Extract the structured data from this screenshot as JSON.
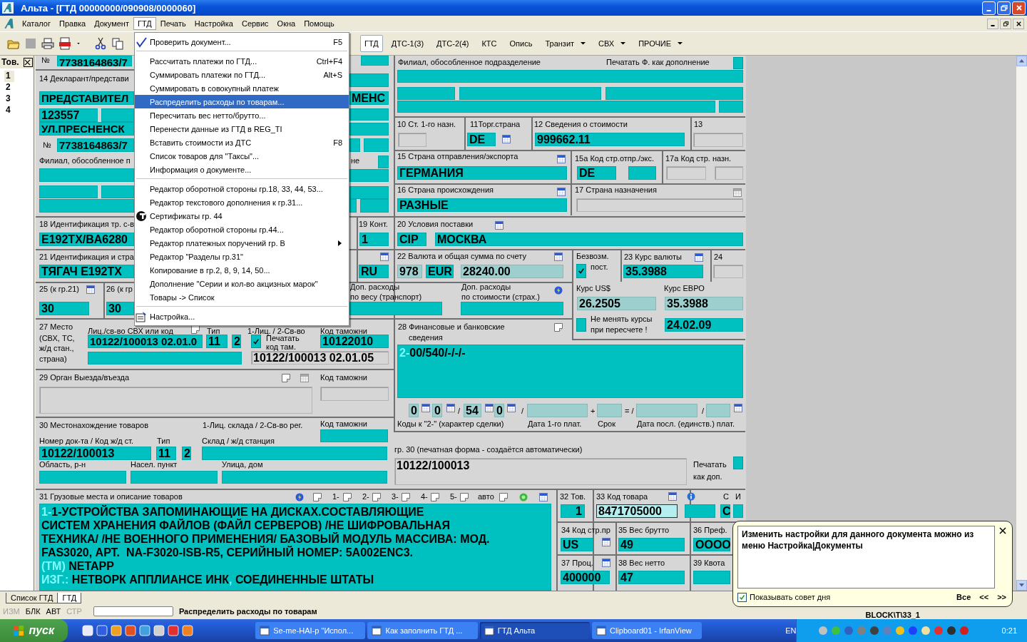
{
  "window": {
    "title": "Альта - [ГТД 00000000/090908/0000060]"
  },
  "menu_bar": [
    {
      "label": "Каталог",
      "open": false
    },
    {
      "label": "Правка",
      "open": false
    },
    {
      "label": "Документ",
      "open": false
    },
    {
      "label": "ГТД",
      "open": true
    },
    {
      "label": "Печать",
      "open": false
    },
    {
      "label": "Настройка",
      "open": false
    },
    {
      "label": "Сервис",
      "open": false
    },
    {
      "label": "Окна",
      "open": false
    },
    {
      "label": "Помощь",
      "open": false
    }
  ],
  "toolbar_tabs": [
    {
      "label": "ГТД",
      "selected": true,
      "dropdown": false
    },
    {
      "label": "ДТС-1(3)",
      "selected": false,
      "dropdown": false
    },
    {
      "label": "ДТС-2(4)",
      "selected": false,
      "dropdown": false
    },
    {
      "label": "КТС",
      "selected": false,
      "dropdown": false
    },
    {
      "label": "Опись",
      "selected": false,
      "dropdown": false
    },
    {
      "label": "Транзит",
      "selected": false,
      "dropdown": true
    },
    {
      "label": "СВХ",
      "selected": false,
      "dropdown": true
    },
    {
      "label": "ПРОЧИЕ",
      "selected": false,
      "dropdown": true
    }
  ],
  "gtd_menu": [
    {
      "kind": "item",
      "label": "Проверить документ...",
      "shortcut": "F5",
      "selected": false,
      "submenu": false
    },
    {
      "kind": "separator"
    },
    {
      "kind": "item",
      "label": "Рассчитать платежи по ГТД...",
      "shortcut": "Ctrl+F4",
      "selected": false,
      "submenu": false
    },
    {
      "kind": "item",
      "label": "Суммировать платежи по ГТД...",
      "shortcut": "Alt+S",
      "selected": false,
      "submenu": false
    },
    {
      "kind": "item",
      "label": "Суммировать в совокупный платеж",
      "selected": false,
      "submenu": false
    },
    {
      "kind": "item",
      "label": "Распределить расходы по товарам...",
      "selected": true,
      "submenu": false
    },
    {
      "kind": "item",
      "label": "Пересчитать вес нетто/брутто...",
      "selected": false,
      "submenu": false
    },
    {
      "kind": "item",
      "label": "Перенести данные из ГТД в REG_TI",
      "selected": false,
      "submenu": false
    },
    {
      "kind": "item",
      "label": "Вставить стоимости из ДТС",
      "shortcut": "F8",
      "selected": false,
      "submenu": false
    },
    {
      "kind": "item",
      "label": "Список товаров для \"Таксы\"...",
      "selected": false,
      "submenu": false
    },
    {
      "kind": "item",
      "label": "Информация о документе...",
      "selected": false,
      "submenu": false
    },
    {
      "kind": "separator"
    },
    {
      "kind": "item",
      "label": "Редактор оборотной стороны гр.18, 33, 44, 53...",
      "selected": false,
      "submenu": false
    },
    {
      "kind": "item",
      "label": "Редактор текстового дополнения к гр.31...",
      "selected": false,
      "submenu": false
    },
    {
      "kind": "item",
      "label": "Сертификаты гр. 44",
      "selected": false,
      "submenu": false
    },
    {
      "kind": "item",
      "label": "Редактор оборотной стороны гр.44...",
      "selected": false,
      "submenu": false
    },
    {
      "kind": "item",
      "label": "Редактор платежных поручений гр. B",
      "selected": false,
      "submenu": true
    },
    {
      "kind": "item",
      "label": "Редактор \"Разделы гр.31\"",
      "selected": false,
      "submenu": false
    },
    {
      "kind": "item",
      "label": "Копирование в гр.2, 8, 9, 14, 50...",
      "selected": false,
      "submenu": false
    },
    {
      "kind": "item",
      "label": "Дополнение \"Серии и кол-во акцизных марок\"",
      "selected": false,
      "submenu": false
    },
    {
      "kind": "item",
      "label": "Товары -> Список",
      "selected": false,
      "submenu": false
    },
    {
      "kind": "separator"
    },
    {
      "kind": "item",
      "label": "Настройка...",
      "selected": false,
      "submenu": false
    }
  ],
  "goods_list": {
    "header": "Тов.",
    "items": [
      {
        "label": "1",
        "selected": true
      },
      {
        "label": "2",
        "selected": false
      },
      {
        "label": "3",
        "selected": false
      },
      {
        "label": "4",
        "selected": false
      }
    ]
  },
  "form": {
    "sections": [
      {
        "labels": [
          "№",
          "14 Декларант/представи",
          "№",
          "Филиал, обособленное п",
          "не"
        ],
        "fields": [
          {
            "value": "7738164863/7"
          },
          {
            "value": "ПРЕДСТАВИТЕЛ"
          },
          {
            "value": "МЕНС"
          },
          {
            "value": "123557"
          },
          {
            "value": "УЛ.ПРЕСНЕНСК"
          },
          {
            "value": "7738164863/7"
          }
        ]
      },
      {
        "labels": [
          "Филиал, обособленное подразделение",
          "Печатать Ф. как дополнение"
        ],
        "checkboxes": [
          {
            "checked": false
          }
        ]
      },
      {
        "labels": [
          "10 Ст. 1-го назн.",
          "11Торг.страна",
          "12 Сведения о стоимости",
          "13"
        ],
        "fields": [
          {
            "value": "DE"
          },
          {
            "value": "999662.11"
          }
        ]
      },
      {
        "labels": [
          "15 Страна отправления/экспорта",
          "15а Код стр.отпр./экс.",
          "17а Код стр. назн."
        ],
        "fields": [
          {
            "value": "ГЕРМАНИЯ"
          },
          {
            "value": "DE"
          }
        ]
      },
      {
        "labels": [
          "16 Страна происхождения",
          "17 Страна назначения"
        ],
        "fields": [
          {
            "value": "РАЗНЫЕ"
          }
        ]
      },
      {
        "labels": [
          "18 Идентификация тр. с-в",
          "19 Конт.",
          "20 Условия поставки"
        ],
        "fields": [
          {
            "value": "E192TX/BA6280"
          },
          {
            "value": "1"
          },
          {
            "value": "CIP"
          },
          {
            "value": "МОСКВА"
          }
        ]
      },
      {
        "labels": [
          "21 Идентификация и стра",
          "22 Валюта и общая сумма по счету",
          "Безвозм.",
          "пост.",
          "23 Курс валюты",
          "24"
        ],
        "fields": [
          {
            "value": "ТЯГАЧ E192TX"
          },
          {
            "value": "RU"
          },
          {
            "value": "978"
          },
          {
            "value": "EUR"
          },
          {
            "value": "28240.00"
          },
          {
            "value": "35.3988"
          }
        ],
        "checkboxes": [
          {
            "checked": true
          }
        ]
      },
      {
        "labels": [
          "25 (к гр.21)",
          "26 (к гр",
          "Доп. расходы",
          "по весу (транспорт)",
          "Доп. расходы",
          "по стоимости (страх.)"
        ],
        "fields": [
          {
            "value": "30"
          },
          {
            "value": "30"
          }
        ]
      },
      {
        "labels": [
          "Курс US$",
          "Курс ЕВРО",
          "Не менять курсы",
          "при пересчете !"
        ],
        "fields": [
          {
            "value": "26.2505"
          },
          {
            "value": "35.3988"
          },
          {
            "value": "24.02.09"
          }
        ],
        "checkboxes": [
          {
            "checked": false
          }
        ]
      },
      {
        "labels": [
          "27  Место",
          "(СВХ, ТС,",
          "ж/д стан.,",
          "страна)",
          "Лиц./св-во СВХ или код",
          "Тип",
          "1-Лиц. / 2-Св-во",
          "Код таможни",
          "Печатать",
          "код там.",
          "28 Финансовые и банковские",
          "сведения",
          "/",
          "/",
          "+",
          "= /",
          "/",
          "Коды к \"2-\" (характер сделки)",
          "Дата 1-го плат.",
          "Срок",
          "Дата посл. (единств.) плат."
        ],
        "fields": [
          {
            "value": "10122/100013 02.01.0"
          },
          {
            "value": "11"
          },
          {
            "value": "2"
          },
          {
            "value": "10122010"
          },
          {
            "value": "10122/100013 02.01.05"
          },
          {
            "value": "0"
          },
          {
            "value": "0"
          },
          {
            "value": "54"
          },
          {
            "value": "0"
          }
        ],
        "checkboxes": [
          {
            "checked": true
          }
        ]
      },
      {
        "labels": [
          "29 Орган Выезда/въезда",
          "Код таможни"
        ]
      },
      {
        "labels": [
          "30 Местонахождение товаров",
          "1-Лиц. склада / 2-Св-во рег.",
          "Код таможни",
          "Номер док-та / Код ж/д ст.",
          "Тип",
          "Склад / ж/д станция",
          "Область, р-н",
          "Насел. пункт",
          "Улица, дом"
        ],
        "fields": [
          {
            "value": "10122/100013"
          },
          {
            "value": "11"
          },
          {
            "value": "2"
          }
        ]
      },
      {
        "labels": [
          "гр. 30 (печатная форма - создаётся автоматически)",
          "Печатать",
          "как доп."
        ],
        "fields": [
          {
            "value": "10122/100013"
          }
        ],
        "checkboxes": [
          {
            "checked": false
          }
        ]
      },
      {
        "labels": [
          "31 Грузовые места и описание товаров",
          "1-",
          "2-",
          "3-",
          "4-",
          "5-",
          "авто"
        ]
      },
      {
        "labels": [
          "32 Тов.",
          "33 Код товара",
          "С",
          "И",
          "34 Код стр.пр",
          "35 Вес брутто",
          "36 Преф.",
          "37 Проц.",
          "38 Вес нетто",
          "39 Квота"
        ],
        "fields": [
          {
            "value": "1"
          },
          {
            "value": "8471705000"
          },
          {
            "value": "С"
          },
          {
            "value": "US"
          },
          {
            "value": "49"
          },
          {
            "value": "ОООО"
          },
          {
            "value": "400000"
          },
          {
            "value": "47"
          }
        ]
      }
    ],
    "financial_details": [
      {
        "text": "2-",
        "kind": "prefix"
      },
      {
        "text": "00/540/-/-/-",
        "kind": "body"
      }
    ],
    "goods_description": [
      [
        {
          "text": "1-",
          "kind": "prefix"
        },
        {
          "text": "1-УСТРОЙСТВА ЗАПОМИНАЮЩИЕ НА ДИСКАХ.СОСТАВЛЯЮЩИЕ",
          "kind": "body"
        }
      ],
      [
        {
          "text": "СИСТЕМ ХРАНЕНИЯ ФАЙЛОВ (ФАЙЛ СЕРВЕРОВ) /НЕ ШИФРОВАЛЬНАЯ",
          "kind": "body"
        }
      ],
      [
        {
          "text": "ТЕХНИКА/ /НЕ ВОЕННОГО ПРИМЕНЕНИЯ/ БАЗОВЫЙ МОДУЛЬ МАССИВА: МОД.",
          "kind": "body"
        }
      ],
      [
        {
          "text": "FAS3020, АРТ.  NA-F3020-ISB-R5, СЕРИЙНЫЙ НОМЕР: 5A002ENC3.",
          "kind": "body"
        }
      ],
      [
        {
          "text": "(ТМ)",
          "kind": "prefix"
        },
        {
          "text": " NETAPP",
          "kind": "body"
        }
      ],
      [
        {
          "text": "ИЗГ.:",
          "kind": "prefix"
        },
        {
          "text": " НЕТВОРК АППЛИАНСЕ ИНК",
          "kind": "body"
        },
        {
          "text": ",",
          "kind": "prefix"
        },
        {
          "text": " СОЕДИНЕННЫЕ ШТАТЫ",
          "kind": "body"
        }
      ]
    ]
  },
  "document_tabs": [
    {
      "label": "Список ГТД",
      "selected": false
    },
    {
      "label": "ГТД",
      "selected": true
    }
  ],
  "status_bar": {
    "indicators": [
      {
        "label": "ИЗМ",
        "on": false
      },
      {
        "label": "БЛК",
        "on": true
      },
      {
        "label": "АВТ",
        "on": true
      },
      {
        "label": "СТР",
        "on": false
      }
    ],
    "message": "Распределить расходы по товарам",
    "block": "BLOCK\\T\\33_1"
  },
  "tip": {
    "text": "Изменить настройки для данного документа можно из меню Настройка|Документы",
    "show_tips": {
      "label": "Показывать совет дня",
      "checked": true
    },
    "links": [
      "Все",
      "<<",
      ">>"
    ]
  },
  "taskbar": {
    "start": "пуск",
    "tasks": [
      {
        "label": "Se-me-HAI-p \"Испол...",
        "active": false
      },
      {
        "label": "Как заполнить ГТД ...",
        "active": false
      },
      {
        "label": "ГТД Альта",
        "active": true
      },
      {
        "label": "Clipboard01 - IrfanView",
        "active": false
      }
    ],
    "language": "EN",
    "clock": "0:21"
  }
}
